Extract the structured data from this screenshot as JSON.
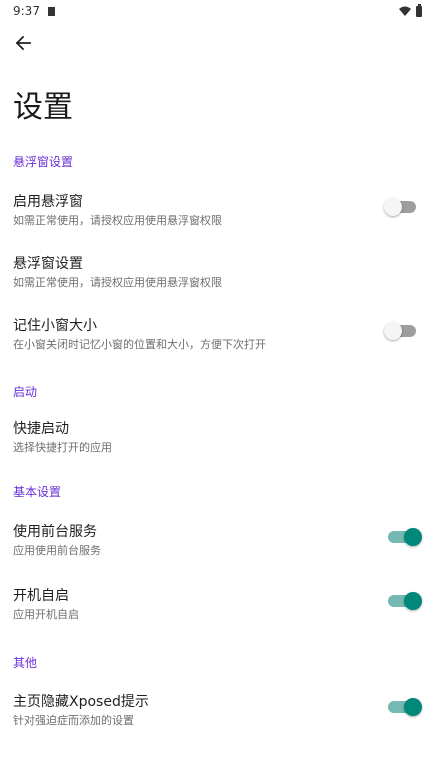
{
  "status_bar": {
    "time": "9:37"
  },
  "header": {
    "back_icon": "arrow-left-icon",
    "title": "设置"
  },
  "sections": [
    {
      "header": "悬浮窗设置",
      "items": [
        {
          "title": "启用悬浮窗",
          "summary": "如需正常使用，请授权应用使用悬浮窗权限",
          "switch": "off"
        },
        {
          "title": "悬浮窗设置",
          "summary": "如需正常使用，请授权应用使用悬浮窗权限"
        },
        {
          "title": "记住小窗大小",
          "summary": "在小窗关闭时记忆小窗的位置和大小，方便下次打开",
          "switch": "off"
        }
      ]
    },
    {
      "header": "启动",
      "items": [
        {
          "title": "快捷启动",
          "summary": "选择快捷打开的应用"
        }
      ]
    },
    {
      "header": "基本设置",
      "items": [
        {
          "title": "使用前台服务",
          "summary": "应用使用前台服务",
          "switch": "on"
        },
        {
          "title": "开机自启",
          "summary": "应用开机自启",
          "switch": "on"
        }
      ]
    },
    {
      "header": "其他",
      "items": [
        {
          "title": "主页隐藏Xposed提示",
          "summary": "针对强迫症而添加的设置",
          "switch": "on"
        }
      ]
    }
  ],
  "colors": {
    "accent": "#6b2fd6",
    "switch_on_track": "#74b9b3",
    "switch_on_thumb": "#00897b",
    "switch_off_track": "#9e9e9e"
  }
}
